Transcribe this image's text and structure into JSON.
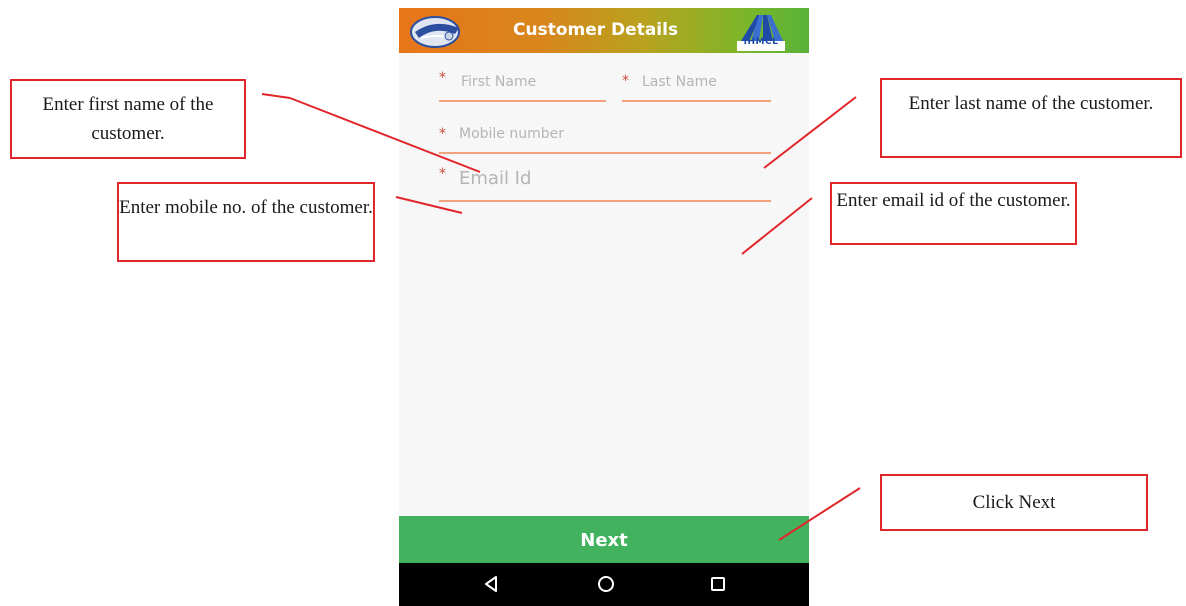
{
  "app": {
    "title": "Customer Details",
    "right_logo_text": "IHMCL"
  },
  "form": {
    "first_name_placeholder": "First Name",
    "last_name_placeholder": "Last Name",
    "mobile_placeholder": "Mobile number",
    "email_placeholder": "Email Id",
    "required_marker": "*"
  },
  "actions": {
    "next_label": "Next"
  },
  "annotations": {
    "first_name": "Enter first name of the customer.",
    "mobile": "Enter mobile no. of the customer.",
    "last_name": "Enter last name of the customer.",
    "email": "Enter email id of the customer.",
    "next": "Click Next"
  },
  "colors": {
    "header_gradient_start": "#e8751a",
    "header_gradient_end": "#59b23a",
    "next_button": "#43b25e",
    "field_underline": "#f0a27a",
    "required_star": "#d04a3a",
    "callout_border": "#e0262b"
  },
  "icons": {
    "left_logo": "toll-logo-icon",
    "right_logo": "highway-logo-icon",
    "nav_back": "triangle-back-icon",
    "nav_home": "circle-home-icon",
    "nav_recents": "square-recents-icon"
  }
}
